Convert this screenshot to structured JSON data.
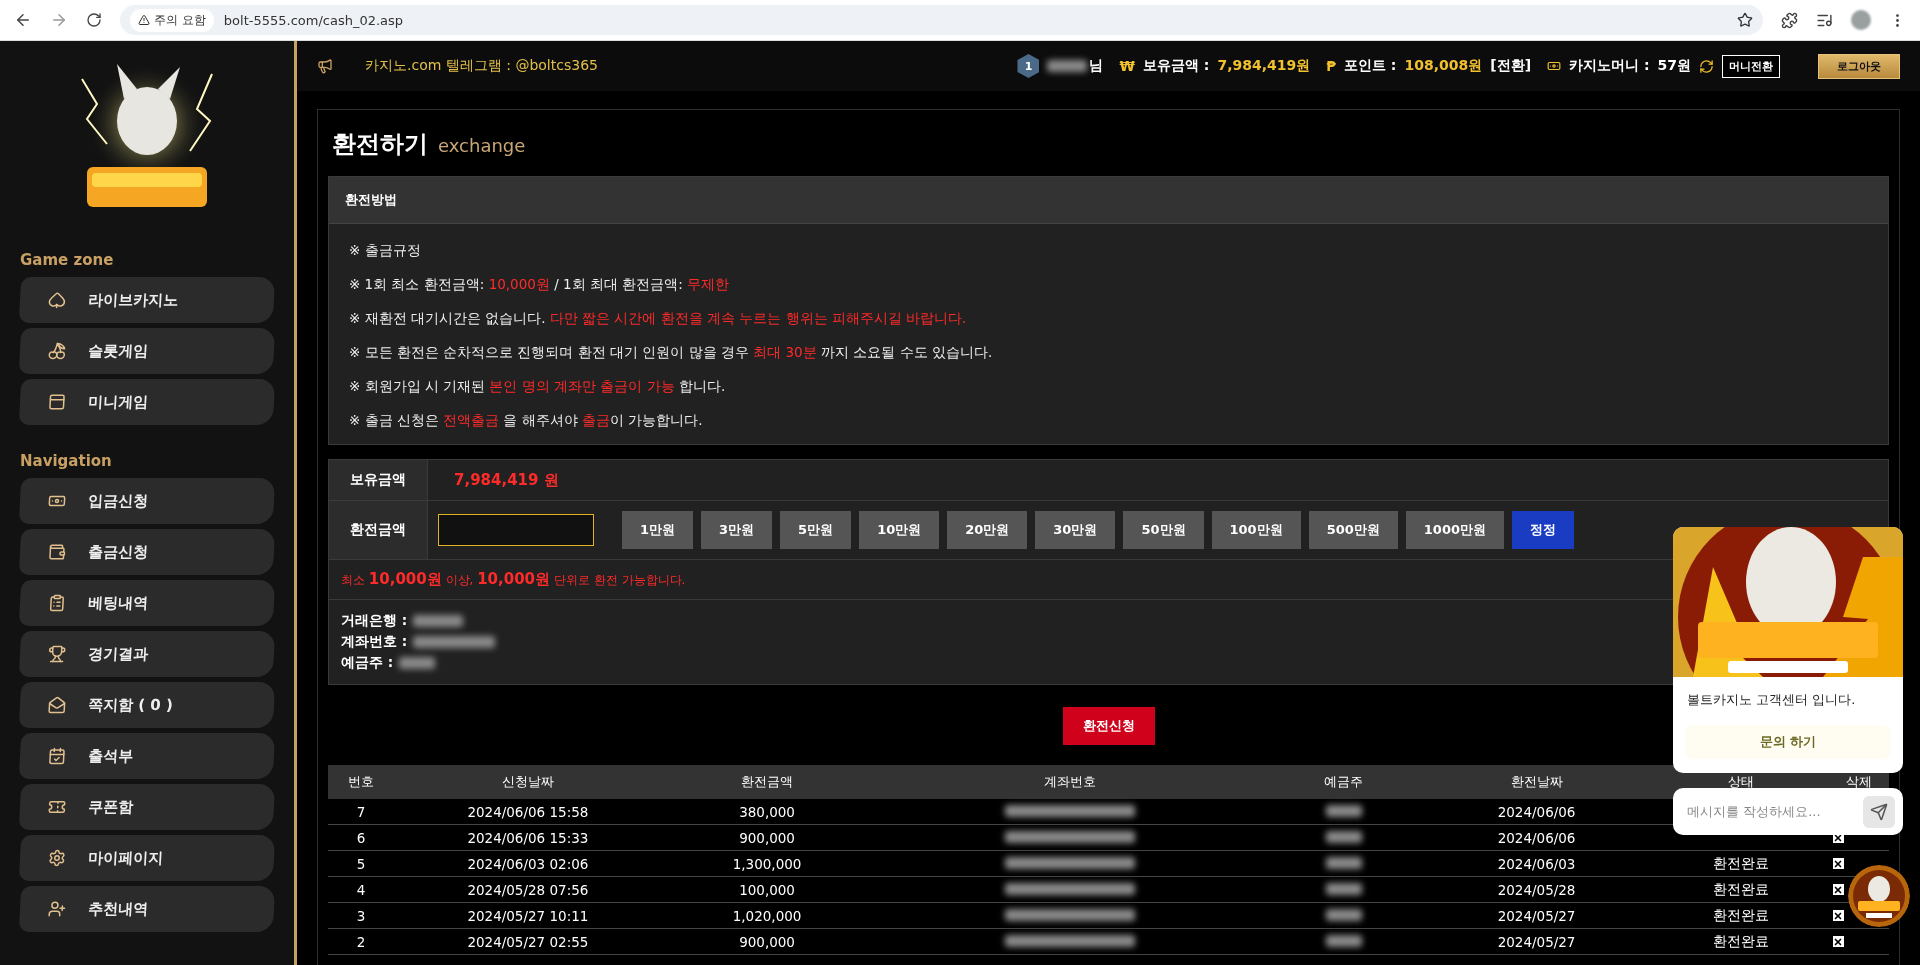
{
  "browser": {
    "warning": "주의 요함",
    "url": "bolt-5555.com/cash_02.asp"
  },
  "sidebar": {
    "sections": [
      {
        "title": "Game zone",
        "items": [
          {
            "label": "라이브카지노"
          },
          {
            "label": "슬롯게임"
          },
          {
            "label": "미니게임"
          }
        ]
      },
      {
        "title": "Navigation",
        "items": [
          {
            "label": "입금신청"
          },
          {
            "label": "출금신청"
          },
          {
            "label": "베팅내역"
          },
          {
            "label": "경기결과"
          },
          {
            "label": "쪽지함 ( 0 )"
          },
          {
            "label": "출석부"
          },
          {
            "label": "쿠폰함"
          },
          {
            "label": "마이페이지"
          },
          {
            "label": "추천내역"
          }
        ]
      }
    ]
  },
  "header": {
    "notice": "카지노.com 텔레그램 : @boltcs365",
    "level": "1",
    "name_suffix": "님",
    "balance_sign": "₩",
    "balance_label": "보유금액 :",
    "balance_value": "7,984,419원",
    "points_sign": "₱",
    "points_label": "포인트 :",
    "points_value": "108,008원",
    "convert_link": "[전환]",
    "casino_money_label": "카지노머니 :",
    "casino_money_value": "57원",
    "buttons": [
      {
        "label": "머니전환",
        "kind": "outline"
      },
      {
        "label": "로그아웃",
        "kind": "gold"
      }
    ]
  },
  "page": {
    "title": "환전하기",
    "subtitle": "exchange"
  },
  "notice": {
    "title": "환전방법",
    "lines": [
      [
        {
          "text": "※ 출금규정",
          "highlight": false
        }
      ],
      [
        {
          "text": "※ 1회 최소 환전금액: ",
          "highlight": false
        },
        {
          "text": "10,000원",
          "highlight": true
        },
        {
          "text": " / 1회 최대 환전금액: ",
          "highlight": false
        },
        {
          "text": "무제한",
          "highlight": true
        }
      ],
      [
        {
          "text": "※ 재환전 대기시간은 없습니다. ",
          "highlight": false
        },
        {
          "text": "다만 짧은 시간에 환전을 계속 누르는 행위는 피해주시길 바랍니다.",
          "highlight": true
        }
      ],
      [
        {
          "text": "※ 모든 환전은 순차적으로 진행되며 환전 대기 인원이 많을 경우 ",
          "highlight": false
        },
        {
          "text": "최대 30분",
          "highlight": true
        },
        {
          "text": " 까지 소요될 수도 있습니다.",
          "highlight": false
        }
      ],
      [
        {
          "text": "※ 회원가입 시 기재된 ",
          "highlight": false
        },
        {
          "text": "본인 명의 계좌만 출금이 가능",
          "highlight": true
        },
        {
          "text": " 합니다.",
          "highlight": false
        }
      ],
      [
        {
          "text": "※ 출금 신청은 ",
          "highlight": false
        },
        {
          "text": "전액출금",
          "highlight": true
        },
        {
          "text": " 을 해주셔야 ",
          "highlight": false
        },
        {
          "text": "출금",
          "highlight": true
        },
        {
          "text": "이 가능합니다.",
          "highlight": false
        }
      ]
    ]
  },
  "form": {
    "balance_label": "보유금액",
    "balance_value": "7,984,419 원",
    "amount_label": "환전금액",
    "quick_amounts": [
      "1만원",
      "3만원",
      "5만원",
      "10만원",
      "20만원",
      "30만원",
      "50만원",
      "100만원",
      "500만원",
      "1000만원"
    ],
    "reset_button": "정정",
    "rule": [
      {
        "text": "최소 ",
        "emphasis": false
      },
      {
        "text": "10,000원",
        "emphasis": true
      },
      {
        "text": " 이상, ",
        "emphasis": false
      },
      {
        "text": "10,000원",
        "emphasis": true
      },
      {
        "text": " 단위로 환전 가능합니다.",
        "emphasis": false
      }
    ],
    "account": [
      {
        "label": "거래은행 :"
      },
      {
        "label": "계좌번호 :"
      },
      {
        "label": "예금주 :"
      }
    ],
    "submit": "환전신청"
  },
  "history": {
    "columns": [
      "번호",
      "신청날짜",
      "환전금액",
      "계좌번호",
      "예금주",
      "환전날짜",
      "상태",
      "삭제"
    ],
    "rows": [
      {
        "no": "7",
        "requested": "2024/06/06 15:58",
        "amount": "380,000",
        "date": "2024/06/06"
      },
      {
        "no": "6",
        "requested": "2024/06/06 15:33",
        "amount": "900,000",
        "date": "2024/06/06"
      },
      {
        "no": "5",
        "requested": "2024/06/03 02:06",
        "amount": "1,300,000",
        "date": "2024/06/03",
        "status": "환전완료"
      },
      {
        "no": "4",
        "requested": "2024/05/28 07:56",
        "amount": "100,000",
        "date": "2024/05/28",
        "status": "환전완료"
      },
      {
        "no": "3",
        "requested": "2024/05/27 10:11",
        "amount": "1,020,000",
        "date": "2024/05/27",
        "status": "환전완료"
      },
      {
        "no": "2",
        "requested": "2024/05/27 02:55",
        "amount": "900,000",
        "date": "2024/05/27",
        "status": "환전완료"
      }
    ]
  },
  "chat": {
    "greeting": "볼트카지노 고객센터 입니다.",
    "inquiry_button": "문의 하기",
    "message_placeholder": "메시지를 작성하세요..."
  }
}
